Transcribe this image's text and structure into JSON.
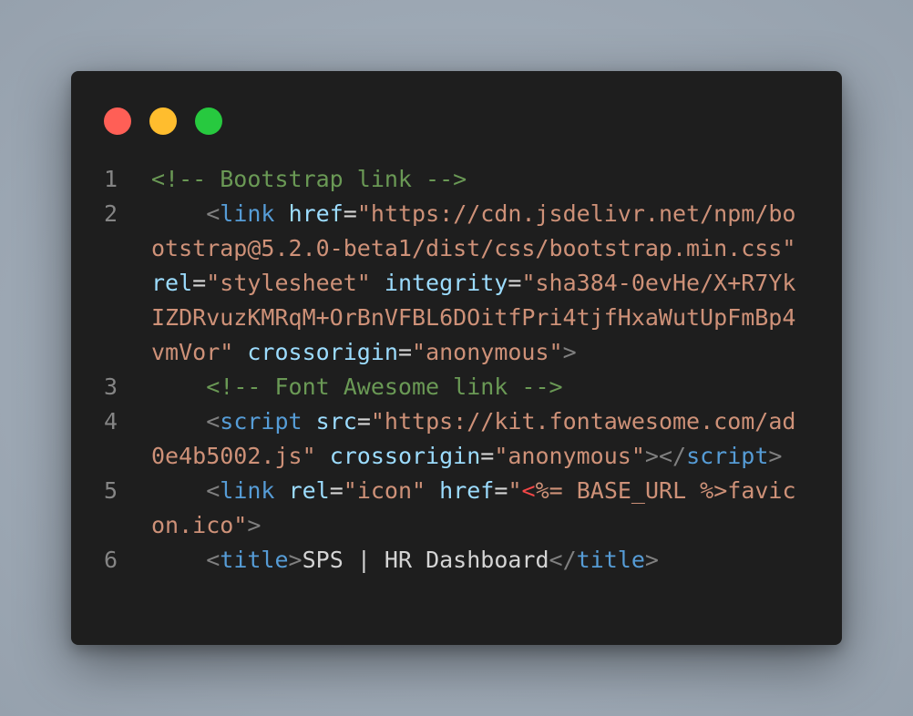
{
  "window": {
    "controls": [
      "close",
      "minimize",
      "maximize"
    ],
    "colors": {
      "close": "#ff5f56",
      "minimize": "#ffbd2e",
      "maximize": "#27c93f"
    }
  },
  "code": {
    "lines": [
      {
        "number": "1",
        "tokens": [
          {
            "type": "comment",
            "text": "<!-- Bootstrap link -->"
          }
        ]
      },
      {
        "number": "2",
        "tokens": [
          {
            "type": "text",
            "text": "    "
          },
          {
            "type": "punct",
            "text": "<"
          },
          {
            "type": "tag",
            "text": "link"
          },
          {
            "type": "text",
            "text": " "
          },
          {
            "type": "attr",
            "text": "href"
          },
          {
            "type": "text",
            "text": "="
          },
          {
            "type": "string",
            "text": "\"https://cdn.jsdelivr.net/npm/bootstrap@5.2.0-beta1/dist/css/bootstrap.min.css\""
          },
          {
            "type": "text",
            "text": " "
          },
          {
            "type": "attr",
            "text": "rel"
          },
          {
            "type": "text",
            "text": "="
          },
          {
            "type": "string",
            "text": "\"stylesheet\""
          },
          {
            "type": "text",
            "text": " "
          },
          {
            "type": "attr",
            "text": "integrity"
          },
          {
            "type": "text",
            "text": "="
          },
          {
            "type": "string",
            "text": "\"sha384-0evHe/X+R7YkIZDRvuzKMRqM+OrBnVFBL6DOitfPri4tjfHxaWutUpFmBp4vmVor\""
          },
          {
            "type": "text",
            "text": " "
          },
          {
            "type": "attr",
            "text": "crossorigin"
          },
          {
            "type": "text",
            "text": "="
          },
          {
            "type": "string",
            "text": "\"anonymous\""
          },
          {
            "type": "punct",
            "text": ">"
          }
        ]
      },
      {
        "number": "3",
        "tokens": [
          {
            "type": "text",
            "text": "    "
          },
          {
            "type": "comment",
            "text": "<!-- Font Awesome link -->"
          }
        ]
      },
      {
        "number": "4",
        "tokens": [
          {
            "type": "text",
            "text": "    "
          },
          {
            "type": "punct",
            "text": "<"
          },
          {
            "type": "tag",
            "text": "script"
          },
          {
            "type": "text",
            "text": " "
          },
          {
            "type": "attr",
            "text": "src"
          },
          {
            "type": "text",
            "text": "="
          },
          {
            "type": "string",
            "text": "\"https://kit.fontawesome.com/ad0e4b5002.js\""
          },
          {
            "type": "text",
            "text": " "
          },
          {
            "type": "attr",
            "text": "crossorigin"
          },
          {
            "type": "text",
            "text": "="
          },
          {
            "type": "string",
            "text": "\"anonymous\""
          },
          {
            "type": "punct",
            "text": "></"
          },
          {
            "type": "tag",
            "text": "script"
          },
          {
            "type": "punct",
            "text": ">"
          }
        ]
      },
      {
        "number": "5",
        "tokens": [
          {
            "type": "text",
            "text": "    "
          },
          {
            "type": "punct",
            "text": "<"
          },
          {
            "type": "tag",
            "text": "link"
          },
          {
            "type": "text",
            "text": " "
          },
          {
            "type": "attr",
            "text": "rel"
          },
          {
            "type": "text",
            "text": "="
          },
          {
            "type": "string",
            "text": "\"icon\""
          },
          {
            "type": "text",
            "text": " "
          },
          {
            "type": "attr",
            "text": "href"
          },
          {
            "type": "text",
            "text": "="
          },
          {
            "type": "string",
            "text": "\""
          },
          {
            "type": "error",
            "text": "<"
          },
          {
            "type": "string",
            "text": "%= BASE_URL %>favicon.ico\""
          },
          {
            "type": "punct",
            "text": ">"
          }
        ]
      },
      {
        "number": "6",
        "tokens": [
          {
            "type": "text",
            "text": "    "
          },
          {
            "type": "punct",
            "text": "<"
          },
          {
            "type": "tag",
            "text": "title"
          },
          {
            "type": "punct",
            "text": ">"
          },
          {
            "type": "text",
            "text": "SPS | HR Dashboard"
          },
          {
            "type": "punct",
            "text": "</"
          },
          {
            "type": "tag",
            "text": "title"
          },
          {
            "type": "punct",
            "text": ">"
          }
        ]
      }
    ]
  }
}
